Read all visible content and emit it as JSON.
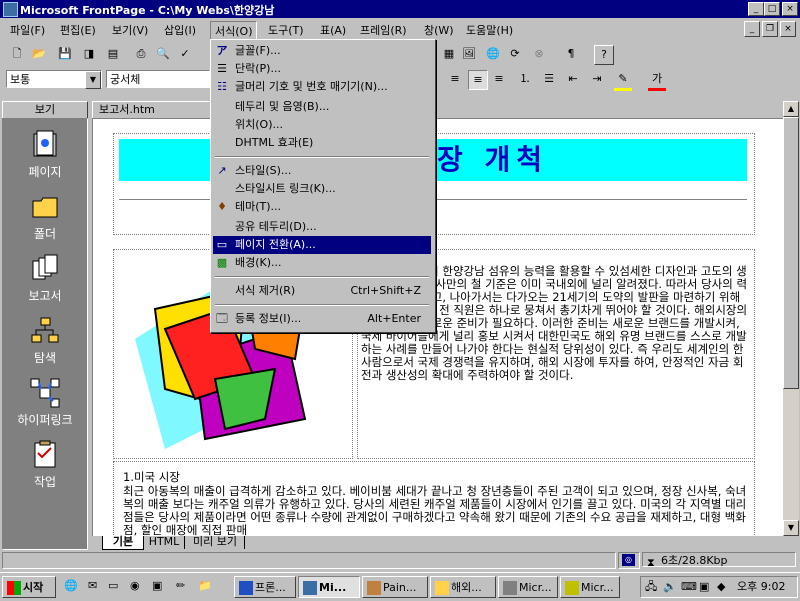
{
  "window": {
    "title": "Microsoft FrontPage - C:\\My Webs\\한양강남",
    "controls": [
      "_",
      "□",
      "×"
    ]
  },
  "menubar": [
    "파일(F)",
    "편집(E)",
    "보기(V)",
    "삽입(I)",
    "서식(O)",
    "도구(T)",
    "표(A)",
    "프레임(R)",
    "창(W)",
    "도움말(H)"
  ],
  "toolbar2": {
    "style_value": "보통",
    "font_value": "궁서체"
  },
  "view_bar": {
    "header": "보기",
    "items": [
      "페이지",
      "폴더",
      "보고서",
      "탐색",
      "하이퍼링크",
      "작업"
    ]
  },
  "document": {
    "tab_label": "보고서.htm",
    "banner_text": "장 개척",
    "right_paragraph": "아직까지도 우리 한양강남 섬유의 능력을 활용할 수 있섬세한 디자인과 고도의 생산성, 그리고 당사만의 철 기준은 이미 국내외에 널리 알려졌다. 따라서 당사의 력을 극대화 시키고, 나아가서는 다가오는 21세기의 도약의 발판을 마련하기 위해서, 우리 회사의 전 직원은 하나로 뭉쳐서 총기차게 뛰어야 할 것이다. 해외시장의 개척을 위해 새로운 준비가 필요하다. 이러한 준비는 새로운 브랜드를 개발시켜, 국제 바이어들에게 널리 홍보 시켜서 대한민국도 해외 유명 브랜드를 스스로 개발하는 사례를 만들어 나가야 한다는 현실적 당위성이 있다. 즉 우리도 세계인의 한 사람으로서 국제 경쟁력을 유지하며, 해외 시장에 투자를 하여, 안정적인 자금 회전과 생산성의 확대에 주력하여야 할 것이다.",
    "section_heading": "1.미국 시장",
    "section_paragraph": "최근 아동복의 매출이 급격하게 감소하고 있다. 베이비붐 세대가 끝나고 청 장년층들이 주된 고객이 되고 있으며, 정장 신사복, 숙녀복의 매출 보다는 캐주얼 의류가 유행하고 있다. 당사의 세련된 캐주얼 제품들이 시장에서 인기를 끌고 있다. 미국의 각 지역별 대리점들은 당사의 제품이라면 어떤 종류나 수량에 관계없이 구매하겠다고 약속해 왔기 때문에 기존의 수요 공급을 재제하고, 대형 백화점, 할인 매장에 직접 판매",
    "bottom_tabs": [
      "기본",
      "HTML",
      "미리 보기"
    ]
  },
  "format_menu": {
    "items": [
      {
        "icon": "font-icon",
        "label": "글꼴(F)...",
        "shortcut": ""
      },
      {
        "icon": "paragraph-icon",
        "label": "단락(P)...",
        "shortcut": ""
      },
      {
        "icon": "bullets-icon",
        "label": "글머리 기호 및 번호 매기기(N)...",
        "shortcut": ""
      },
      {
        "icon": "",
        "label": "테두리 및 음영(B)...",
        "shortcut": ""
      },
      {
        "icon": "",
        "label": "위치(O)...",
        "shortcut": ""
      },
      {
        "icon": "",
        "label": "DHTML 효과(E)",
        "shortcut": ""
      },
      {
        "icon": "style-icon",
        "label": "스타일(S)...",
        "shortcut": ""
      },
      {
        "icon": "",
        "label": "스타일시트 링크(K)...",
        "shortcut": ""
      },
      {
        "icon": "theme-icon",
        "label": "테마(T)...",
        "shortcut": ""
      },
      {
        "icon": "",
        "label": "공유 테두리(D)...",
        "shortcut": ""
      },
      {
        "icon": "page-transition-icon",
        "label": "페이지 전환(A)...",
        "shortcut": ""
      },
      {
        "icon": "background-icon",
        "label": "배경(K)...",
        "shortcut": ""
      },
      {
        "icon": "",
        "label": "서식 제거(R)",
        "shortcut": "Ctrl+Shift+Z"
      },
      {
        "icon": "properties-icon",
        "label": "등록 정보(I)...",
        "shortcut": "Alt+Enter"
      }
    ],
    "selected": "페이지 전환(A)..."
  },
  "statusbar": {
    "download_time": "6초/28.8Kbp"
  },
  "taskbar": {
    "start_label": "시작",
    "tasks": [
      "프론...",
      "Mi...",
      "Pain...",
      "해외...",
      "Micr...",
      "Micr..."
    ],
    "clock": "오후 9:02"
  },
  "colors": {
    "title_bar": "#000080",
    "banner_bg": "#00ffff",
    "banner_text": "#0000c0",
    "menu_highlight": "#000080",
    "viewbar_bg": "#808080"
  }
}
